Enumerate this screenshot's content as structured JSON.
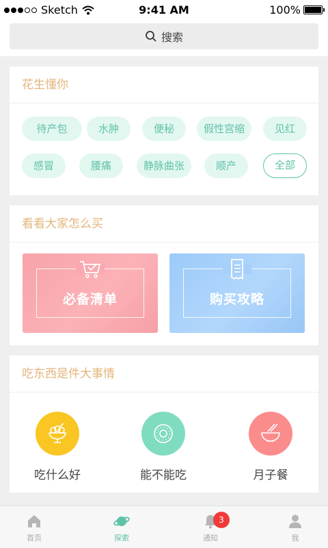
{
  "status_bar": {
    "carrier": "Sketch",
    "time": "9:41 AM",
    "battery": "100%"
  },
  "search": {
    "placeholder": "搜索"
  },
  "section_know": {
    "title": "花生懂你",
    "tags": [
      "待产包",
      "水肿",
      "便秘",
      "假性宫缩",
      "见红",
      "感冒",
      "腰痛",
      "静脉曲张",
      "顺产"
    ],
    "all_label": "全部"
  },
  "section_buy": {
    "title": "看看大家怎么买",
    "cards": [
      {
        "label": "必备清单",
        "icon": "cart-check-icon",
        "color": "#f7a3aa"
      },
      {
        "label": "购买攻略",
        "icon": "receipt-icon",
        "color": "#9ccafa"
      }
    ]
  },
  "section_eat": {
    "title": "吃东西是件大事情",
    "items": [
      {
        "label": "吃什么好",
        "icon": "dessert-cup-icon",
        "color": "#f9c623"
      },
      {
        "label": "能不能吃",
        "icon": "donut-icon",
        "color": "#7fdcc0"
      },
      {
        "label": "月子餐",
        "icon": "noodle-bowl-icon",
        "color": "#fb8c8c"
      }
    ]
  },
  "tab_bar": {
    "tabs": [
      {
        "label": "首页",
        "icon": "home-icon"
      },
      {
        "label": "探索",
        "icon": "planet-icon",
        "active": true
      },
      {
        "label": "通知",
        "icon": "bell-icon",
        "badge": "3"
      },
      {
        "label": "我",
        "icon": "person-icon"
      }
    ]
  },
  "colors": {
    "accent": "#5fc2a9",
    "section_title": "#e3b57b",
    "badge": "#f03a3a"
  }
}
